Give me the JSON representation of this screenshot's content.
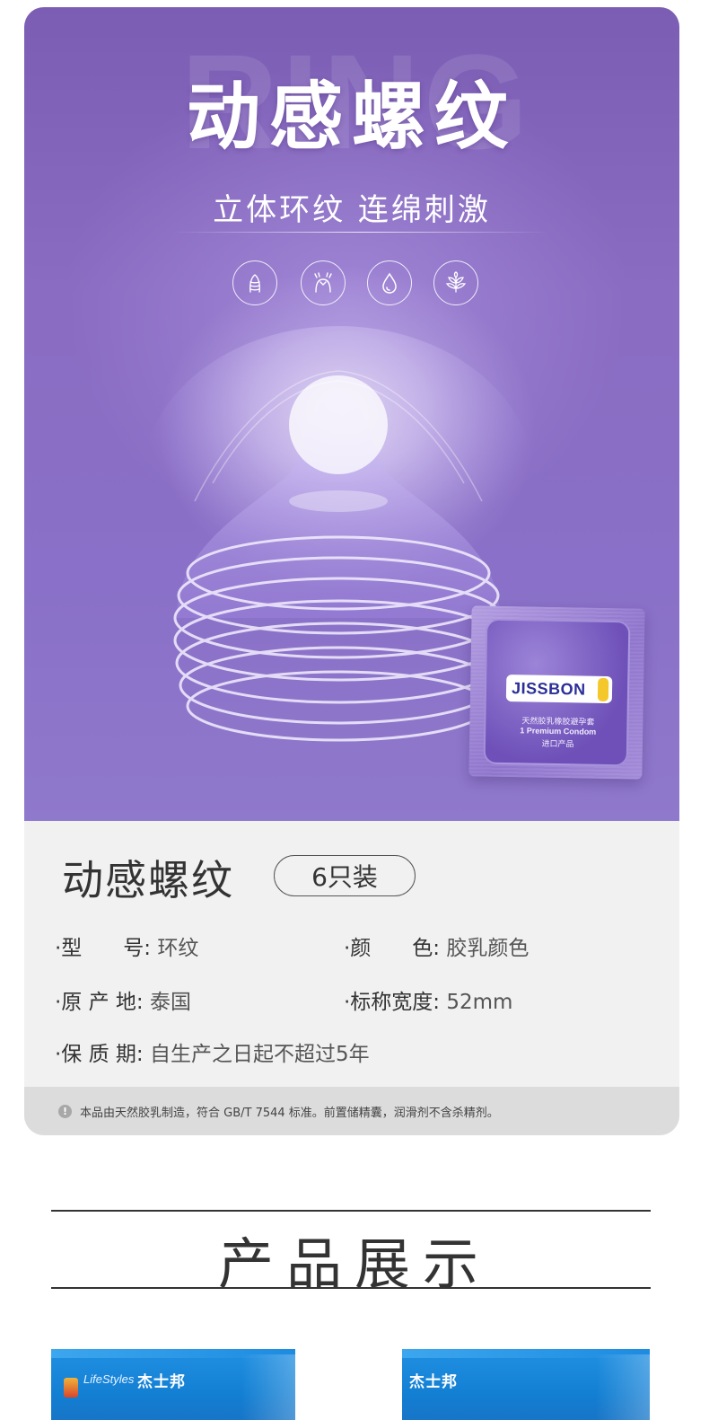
{
  "hero": {
    "watermark": "RING",
    "title": "动感螺纹",
    "subtitle": "立体环纹 连绵刺激",
    "feature_icons": [
      "ribbed-icon",
      "stimulation-icon",
      "drop-icon",
      "leaf-icon"
    ]
  },
  "packet": {
    "brand": "JISSBON",
    "line1": "天然胶乳橡胶避孕套",
    "line2": "1 Premium Condom",
    "line3": "进口产品"
  },
  "spec": {
    "name": "动感螺纹",
    "badge": "6只装",
    "rows": [
      {
        "label": "·型　　号:",
        "value": "环纹"
      },
      {
        "label": "·颜　　色:",
        "value": "胶乳颜色"
      },
      {
        "label": "·原 产 地:",
        "value": "泰国"
      },
      {
        "label": "·标称宽度:",
        "value": "52mm"
      },
      {
        "label": "·保 质 期:",
        "value": "自生产之日起不超过5年"
      }
    ],
    "notice": "本品由天然胶乳制造，符合 GB/T 7544 标准。前置储精囊，润滑剂不含杀精剂。"
  },
  "section": {
    "title": "产品展示"
  },
  "boxes": [
    {
      "brand": "杰士邦",
      "sub_brand": "LifeStyles"
    },
    {
      "brand": "杰士邦"
    }
  ],
  "colors": {
    "hero_purple": "#8a6cc2",
    "panel_gray": "#f1f1f1",
    "notice_gray": "#dcdcdc",
    "box_blue": "#137fd3"
  }
}
